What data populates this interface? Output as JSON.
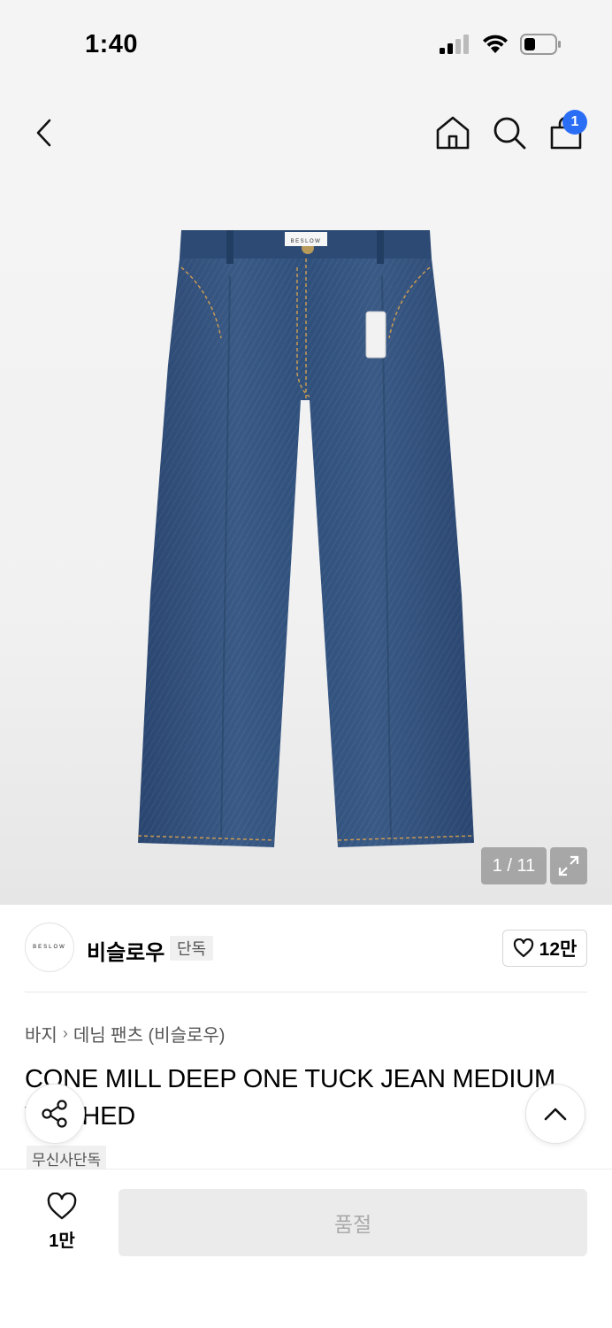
{
  "status_bar": {
    "time": "1:40"
  },
  "nav": {
    "cart_badge": "1",
    "icons": [
      "back-arrow-icon",
      "home-icon",
      "search-icon",
      "shopping-bag-icon"
    ]
  },
  "gallery": {
    "counter": "1 / 11",
    "jeans_label": "BESLOW"
  },
  "brand": {
    "logo_text": "BESLOW",
    "name": "비슬로우",
    "tag": "단독",
    "like_count": "12만"
  },
  "product": {
    "breadcrumb": [
      "바지",
      "데님 팬츠 (비슬로우)"
    ],
    "title": "CONE MILL DEEP ONE TUCK JEAN MEDIUM WASHED",
    "exclusive_tag": "무신사단독"
  },
  "bottom_bar": {
    "wish_count": "1만",
    "buy_label": "품절"
  },
  "colors": {
    "accent": "#2b6ef6",
    "denim": "#2f4f7c"
  }
}
